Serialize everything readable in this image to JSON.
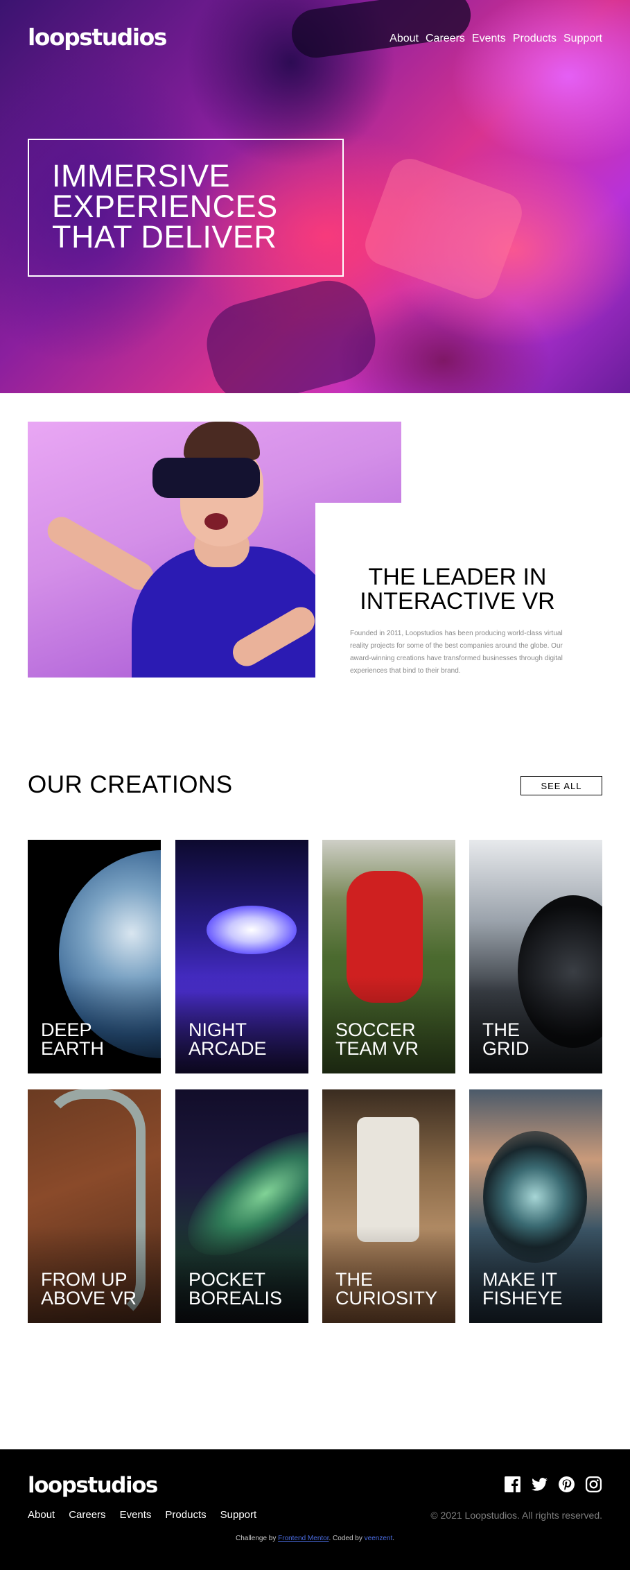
{
  "header": {
    "logo": "loopstudios",
    "nav": [
      "About",
      "Careers",
      "Events",
      "Products",
      "Support"
    ]
  },
  "hero": {
    "headline_lines": [
      "IMMERSIVE",
      "EXPERIENCES",
      "THAT DELIVER"
    ]
  },
  "intro": {
    "title_lines": [
      "THE LEADER IN",
      "INTERACTIVE VR"
    ],
    "body": "Founded in 2011, Loopstudios has been producing world-class virtual reality projects for some of the best companies around the globe. Our award-winning creations have transformed businesses through digital experiences that bind to their brand."
  },
  "creations": {
    "heading": "OUR CREATIONS",
    "see_all": "SEE ALL",
    "items": [
      {
        "line1": "DEEP",
        "line2": "EARTH"
      },
      {
        "line1": "NIGHT",
        "line2": "ARCADE"
      },
      {
        "line1": "SOCCER",
        "line2": "TEAM VR"
      },
      {
        "line1": "THE",
        "line2": "GRID"
      },
      {
        "line1": "FROM UP",
        "line2": "ABOVE VR"
      },
      {
        "line1": "POCKET",
        "line2": "BOREALIS"
      },
      {
        "line1": "THE",
        "line2": "CURIOSITY"
      },
      {
        "line1": "MAKE IT",
        "line2": "FISHEYE"
      }
    ]
  },
  "footer": {
    "logo": "loopstudios",
    "nav": [
      "About",
      "Careers",
      "Events",
      "Products",
      "Support"
    ],
    "copyright": "© 2021 Loopstudios. All rights reserved.",
    "attribution_prefix": "Challenge by ",
    "attribution_link": "Frontend Mentor",
    "attribution_middle": ". Coded by ",
    "attribution_coder": "veenzent",
    "attribution_suffix": ".",
    "socials": [
      "facebook-icon",
      "twitter-icon",
      "pinterest-icon",
      "instagram-icon"
    ]
  },
  "colors": {
    "page_background": "#ffffff",
    "footer_background": "#000000",
    "link_accent": "#4a6bdf",
    "muted_text": "#8a8a8a"
  }
}
